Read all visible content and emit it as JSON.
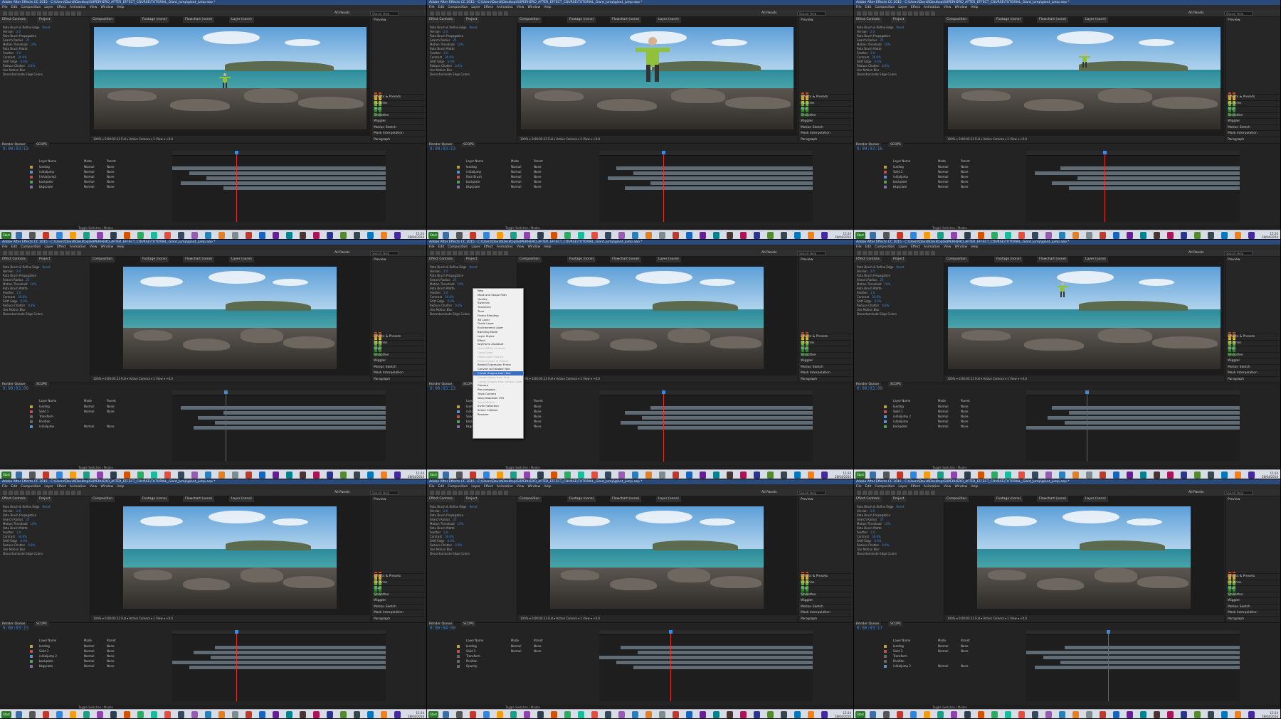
{
  "app": {
    "title": "Adobe After Effects CC 2015 - C:\\Users\\David\\Desktop\\SUPERHERO_AFTER_EFFECT_COURSE\\TUTORIAL_Giant_Jump\\giant_jump.aep *",
    "menu": [
      "File",
      "Edit",
      "Composition",
      "Layer",
      "Effect",
      "Animation",
      "View",
      "Window",
      "Help"
    ],
    "workspace": "All Panels",
    "search_placeholder": "Search Help",
    "panel_tabs": {
      "project": "Project",
      "effect_controls": "Effect Controls",
      "composition": "Composition",
      "footage": "Footage (none)",
      "flowchart": "Flowchart (none)",
      "layer": "Layer (none)"
    },
    "right_sections": [
      "Preview",
      "Effects & Presets",
      "Libraries",
      "Align",
      "Smoother",
      "Wiggler",
      "Motion Sketch",
      "Mask Interpolation",
      "Paragraph"
    ],
    "right_head": "Preview",
    "viewer_controls": "100%  ▾  0:00:03:13  Full  ▾  Active Camera  ▾  1 View  ▾  +0.0",
    "render_queue": "Render Queue",
    "comp_tab": "SCOPE",
    "toggle": "Toggle Switches / Modes",
    "start_label": "Start",
    "clock_time": "15:24",
    "clock_date": "28/04/2016"
  },
  "effect_props": [
    {
      "name": "Roto Brush & Refine Edge",
      "value": "Reset"
    },
    {
      "name": "Version",
      "value": "2.0"
    },
    {
      "name": "Roto Brush Propagation",
      "value": ""
    },
    {
      "name": "Search Radius",
      "value": "25"
    },
    {
      "name": "Motion Threshold",
      "value": "10%"
    },
    {
      "name": "Roto Brush Matte",
      "value": ""
    },
    {
      "name": "Feather",
      "value": "2.0"
    },
    {
      "name": "Contrast",
      "value": "30.0%"
    },
    {
      "name": "Shift Edge",
      "value": "0.0%"
    },
    {
      "name": "Reduce Chatter",
      "value": "0.0%"
    },
    {
      "name": "Use Motion Blur",
      "value": ""
    },
    {
      "name": "Decontaminate Edge Colors",
      "value": ""
    }
  ],
  "layer_columns": [
    "Layer Name",
    "Mode",
    "T TrkMat",
    "Parent"
  ],
  "panes": [
    {
      "time": "0:00:03:13",
      "layers": [
        {
          "name": "landing",
          "mode": "Normal",
          "parent": "None",
          "color": "#c0a040"
        },
        {
          "name": "initialjump",
          "mode": "Normal",
          "parent": "None",
          "color": "#5a8fd0"
        },
        {
          "name": "[initialjump]",
          "mode": "Normal",
          "parent": "None",
          "color": "#c05050"
        },
        {
          "name": "backplate",
          "mode": "Normal",
          "parent": "None",
          "color": "#50a060"
        },
        {
          "name": "bkgrplate",
          "mode": "Normal",
          "parent": "None",
          "color": "#8a6ab0"
        }
      ]
    },
    {
      "time": "0:00:03:13",
      "layers": [
        {
          "name": "landing",
          "mode": "Normal",
          "parent": "None",
          "color": "#c0a040"
        },
        {
          "name": "initialjump",
          "mode": "Normal",
          "parent": "None",
          "color": "#5a8fd0"
        },
        {
          "name": "Roto Brush",
          "mode": "Normal",
          "parent": "None",
          "color": "#c05050"
        },
        {
          "name": "backplate",
          "mode": "Normal",
          "parent": "None",
          "color": "#50a060"
        },
        {
          "name": "bkgrplate",
          "mode": "Normal",
          "parent": "None",
          "color": "#8a6ab0"
        }
      ]
    },
    {
      "time": "0:00:03:16",
      "layers": [
        {
          "name": "landing",
          "mode": "Normal",
          "parent": "None",
          "color": "#c0a040"
        },
        {
          "name": "Solid 2",
          "mode": "Normal",
          "parent": "None",
          "color": "#c05050"
        },
        {
          "name": "initialjump",
          "mode": "Normal",
          "parent": "None",
          "color": "#5a8fd0"
        },
        {
          "name": "backplate",
          "mode": "Normal",
          "parent": "None",
          "color": "#50a060"
        },
        {
          "name": "bkgrplate",
          "mode": "Normal",
          "parent": "None",
          "color": "#8a6ab0"
        }
      ]
    },
    {
      "time": "0:00:03:00",
      "layers": [
        {
          "name": "landing",
          "mode": "Normal",
          "parent": "None",
          "color": "#c0a040"
        },
        {
          "name": "Solid 1",
          "mode": "Normal",
          "parent": "None",
          "color": "#c05050"
        },
        {
          "name": "Transform",
          "mode": "",
          "parent": "",
          "color": "#666"
        },
        {
          "name": "Position",
          "mode": "",
          "parent": "",
          "color": "#666"
        },
        {
          "name": "initialjump",
          "mode": "Normal",
          "parent": "None",
          "color": "#5a8fd0"
        }
      ]
    },
    {
      "time": "0:00:03:13",
      "layers": [
        {
          "name": "landing",
          "mode": "Normal",
          "parent": "None",
          "color": "#c0a040"
        },
        {
          "name": "initialjump",
          "mode": "Normal",
          "parent": "None",
          "color": "#5a8fd0"
        },
        {
          "name": "Solid 1",
          "mode": "Normal",
          "parent": "None",
          "color": "#c05050"
        },
        {
          "name": "backplate",
          "mode": "Normal",
          "parent": "None",
          "color": "#50a060"
        },
        {
          "name": "bkgrplate",
          "mode": "Normal",
          "parent": "None",
          "color": "#8a6ab0"
        }
      ]
    },
    {
      "time": "0:00:03:09",
      "layers": [
        {
          "name": "landing",
          "mode": "Normal",
          "parent": "None",
          "color": "#c0a040"
        },
        {
          "name": "Solid 1",
          "mode": "Normal",
          "parent": "None",
          "color": "#c05050"
        },
        {
          "name": "initialjump 2",
          "mode": "Normal",
          "parent": "None",
          "color": "#5a8fd0"
        },
        {
          "name": "initialjump",
          "mode": "Normal",
          "parent": "None",
          "color": "#5a8fd0"
        },
        {
          "name": "backplate",
          "mode": "Normal",
          "parent": "None",
          "color": "#50a060"
        }
      ]
    },
    {
      "time": "0:00:03:13",
      "layers": [
        {
          "name": "landing",
          "mode": "Normal",
          "parent": "None",
          "color": "#c0a040"
        },
        {
          "name": "Solid 2",
          "mode": "Normal",
          "parent": "None",
          "color": "#c05050"
        },
        {
          "name": "initialjump 2",
          "mode": "Normal",
          "parent": "None",
          "color": "#5a8fd0"
        },
        {
          "name": "backplate",
          "mode": "Normal",
          "parent": "None",
          "color": "#50a060"
        },
        {
          "name": "bkgrplate",
          "mode": "Normal",
          "parent": "None",
          "color": "#8a6ab0"
        }
      ]
    },
    {
      "time": "0:00:04:00",
      "layers": [
        {
          "name": "landing",
          "mode": "Normal",
          "parent": "None",
          "color": "#c0a040"
        },
        {
          "name": "Solid 2",
          "mode": "Normal",
          "parent": "None",
          "color": "#c05050"
        },
        {
          "name": "Transform",
          "mode": "",
          "parent": "",
          "color": "#666"
        },
        {
          "name": "Position",
          "mode": "",
          "parent": "",
          "color": "#666"
        },
        {
          "name": "Opacity",
          "mode": "",
          "parent": "",
          "color": "#666"
        }
      ]
    },
    {
      "time": "0:00:03:17",
      "layers": [
        {
          "name": "landing",
          "mode": "Normal",
          "parent": "None",
          "color": "#c0a040"
        },
        {
          "name": "Solid 2",
          "mode": "Normal",
          "parent": "None",
          "color": "#c05050"
        },
        {
          "name": "Transform",
          "mode": "",
          "parent": "",
          "color": "#666"
        },
        {
          "name": "Position",
          "mode": "",
          "parent": "",
          "color": "#666"
        },
        {
          "name": "initialjump 2",
          "mode": "Normal",
          "parent": "None",
          "color": "#5a8fd0"
        }
      ]
    }
  ],
  "context_menu": [
    "New",
    "Mask and Shape Path",
    "Quality",
    "Switches",
    "Transform",
    "Time",
    "Frame Blending",
    "3D Layer",
    "Guide Layer",
    "Environment Layer",
    "Blending Mode",
    "Layer Styles",
    "Effect",
    "Keyframe Assistant",
    "Open Effect Controls",
    "Open Layer",
    "Open Layer Source",
    "Reveal Layer in Project",
    "Reveal Expression Errors",
    "Convert to Editable Text",
    "Create Shapes from Text",
    "Create Masks from Text",
    "Create Shapes from Vector Layer",
    "Camera",
    "Pre-compose...",
    "Track Camera",
    "Warp Stabilizer VFX",
    "Track Motion",
    "Invert Selection",
    "Select Children",
    "Rename"
  ],
  "context_highlight": 20
}
